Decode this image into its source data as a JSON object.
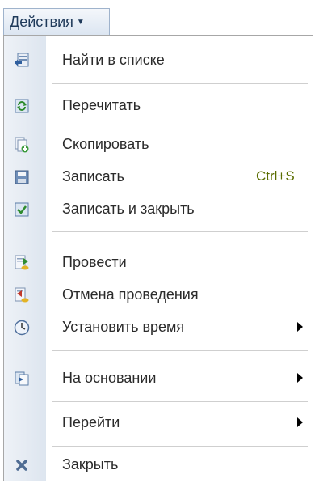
{
  "actions_button": {
    "label": "Действия"
  },
  "menu": {
    "items": [
      {
        "label": "Найти в списке",
        "icon": "find-in-list-icon"
      },
      {
        "label": "Перечитать",
        "icon": "reread-icon"
      },
      {
        "label": "Скопировать",
        "icon": "copy-icon"
      },
      {
        "label": "Записать",
        "icon": "save-icon",
        "shortcut": "Ctrl+S"
      },
      {
        "label": "Записать и закрыть",
        "icon": "save-close-icon"
      },
      {
        "label": "Провести",
        "icon": "post-icon"
      },
      {
        "label": "Отмена проведения",
        "icon": "unpost-icon"
      },
      {
        "label": "Установить время",
        "icon": "clock-icon",
        "submenu": true
      },
      {
        "label": "На основании",
        "icon": "based-on-icon",
        "submenu": true
      },
      {
        "label": "Перейти",
        "submenu": true
      },
      {
        "label": "Закрыть",
        "icon": "close-icon"
      }
    ]
  }
}
